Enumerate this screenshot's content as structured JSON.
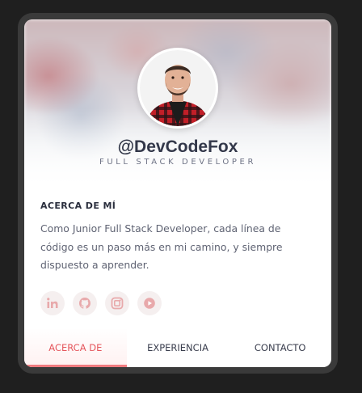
{
  "profile": {
    "handle": "@DevCodeFox",
    "role": "FULL STACK DEVELOPER"
  },
  "about": {
    "title": "ACERCA DE MÍ",
    "text": "Como Junior Full Stack Developer, cada línea de código es un paso más en mi camino, y siempre dispuesto a aprender."
  },
  "socials": [
    {
      "icon": "linkedin-icon"
    },
    {
      "icon": "github-icon"
    },
    {
      "icon": "instagram-icon"
    },
    {
      "icon": "youtube-icon"
    }
  ],
  "tabs": [
    {
      "label": "ACERCA DE",
      "active": true
    },
    {
      "label": "EXPERIENCIA",
      "active": false
    },
    {
      "label": "CONTACTO",
      "active": false
    }
  ],
  "colors": {
    "accent": "#e5575d",
    "icon": "#e8a9ab",
    "text": "#33384a"
  }
}
